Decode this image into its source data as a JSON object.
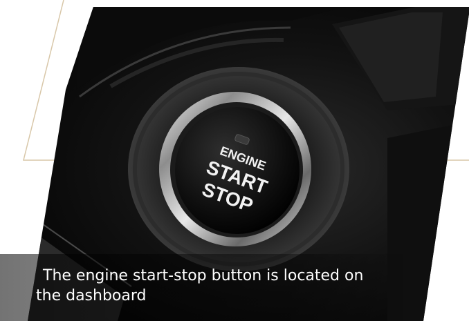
{
  "image": {
    "button_text": [
      "ENGINE",
      "START",
      "STOP"
    ],
    "accent_line_color": "#d8c7a8",
    "ring_color": "#c9c9c9"
  },
  "caption": {
    "line1": "The engine start-stop button is located on",
    "line2": "the dashboard"
  }
}
